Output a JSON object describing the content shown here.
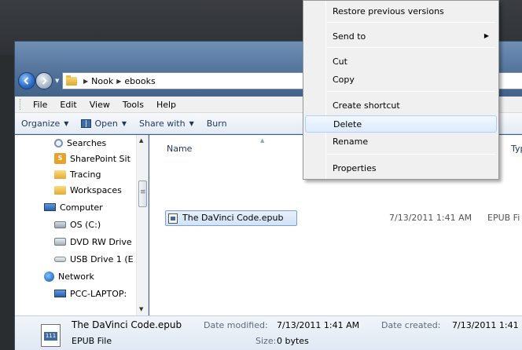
{
  "address": {
    "crumbs": [
      "Nook",
      "ebooks"
    ]
  },
  "menu_bar": [
    "File",
    "Edit",
    "View",
    "Tools",
    "Help"
  ],
  "command_bar": {
    "organize": "Organize",
    "open": "Open",
    "share_with": "Share with",
    "burn": "Burn"
  },
  "nav_tree": [
    {
      "label": "Searches",
      "icon": "search-folder-icon"
    },
    {
      "label": "SharePoint Sit",
      "icon": "sharepoint-icon"
    },
    {
      "label": "Tracing",
      "icon": "folder-icon"
    },
    {
      "label": "Workspaces",
      "icon": "folder-icon"
    },
    {
      "label": "Computer",
      "icon": "computer-icon"
    },
    {
      "label": "OS (C:)",
      "icon": "drive-icon"
    },
    {
      "label": "DVD RW Drive",
      "icon": "dvd-drive-icon"
    },
    {
      "label": "USB Drive 1 (E",
      "icon": "usb-drive-icon"
    },
    {
      "label": "Network",
      "icon": "network-icon"
    },
    {
      "label": "PCC-LAPTOP:",
      "icon": "network-pc-icon"
    }
  ],
  "columns": {
    "name": "Name",
    "type": "Type"
  },
  "file": {
    "name": "The DaVinci Code.epub",
    "date_fragment": "7/13/2011 1:41 AM",
    "type_fragment": "EPUB Fi"
  },
  "details": {
    "filename": "The DaVinci Code.epub",
    "filetype": "EPUB File",
    "modified_label": "Date modified:",
    "modified_value": "7/13/2011 1:41 AM",
    "size_label": "Size:",
    "size_value": "0 bytes",
    "created_label": "Date created:",
    "created_value": "7/13/2011 1:41"
  },
  "context_menu": {
    "restore": "Restore previous versions",
    "send_to": "Send to",
    "cut": "Cut",
    "copy": "Copy",
    "create_shortcut": "Create shortcut",
    "delete": "Delete",
    "rename": "Rename",
    "properties": "Properties"
  }
}
